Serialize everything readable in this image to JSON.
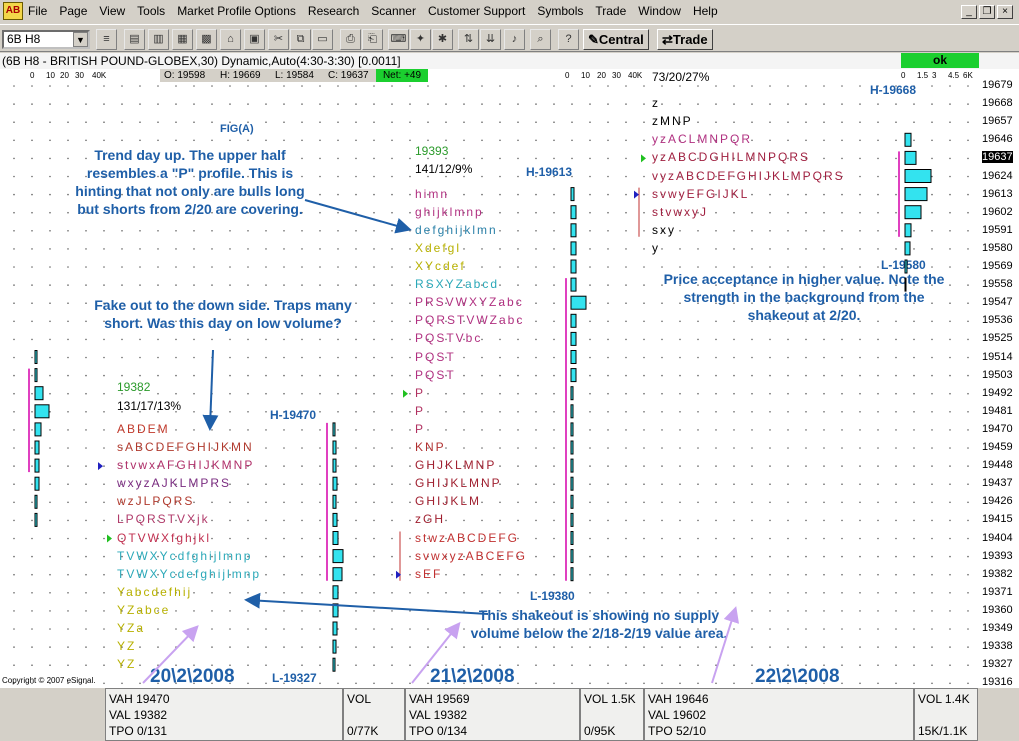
{
  "menu": {
    "items": [
      "File",
      "Page",
      "View",
      "Tools",
      "Market Profile Options",
      "Research",
      "Scanner",
      "Customer Support",
      "Symbols",
      "Trade",
      "Window",
      "Help"
    ]
  },
  "toolbar": {
    "symbol": "6B H8",
    "central_label": "Central",
    "trade_label": "Trade"
  },
  "chart_header": {
    "title": "(6B H8 - BRITISH POUND-GLOBEX,30) Dynamic,Auto(4:30-3:30) [0.0011]",
    "open": "O: 19598",
    "high": "H: 19669",
    "low": "L: 19584",
    "close": "C: 19637",
    "net": "Net: +49",
    "ok": "ok",
    "scale1": [
      "0",
      "10",
      "20",
      "30",
      "40K"
    ],
    "scale2": [
      "0",
      "10",
      "20",
      "30",
      "40K"
    ],
    "scale3": [
      "0",
      "1.5",
      "3",
      "4.5",
      "6K"
    ]
  },
  "prices": [
    "19679",
    "19668",
    "19657",
    "19646",
    "19637",
    "19624",
    "19613",
    "19602",
    "19591",
    "19580",
    "19569",
    "19558",
    "19547",
    "19536",
    "19525",
    "19514",
    "19503",
    "19492",
    "19481",
    "19470",
    "19459",
    "19448",
    "19437",
    "19426",
    "19415",
    "19404",
    "19393",
    "19382",
    "19371",
    "19360",
    "19349",
    "19338",
    "19327",
    "19316"
  ],
  "current_price": "19637",
  "annotations": {
    "fig": "FIG(A)",
    "note_trend": "Trend day up. The upper half resembles a \"P\" profile. This is hinting that not only are bulls long but shorts from 2/20 are covering.",
    "note_fake": "Fake out to the down side. Traps many short. Was this day on low volume?",
    "note_price": "Price acceptance in higher value. Note the strength in the background from the shakeout at 2/20.",
    "note_shake": "This shakeout is showing no supply volume below the 2/18-2/19 value area.",
    "copyright": "Copyright © 2007 eSignal."
  },
  "day1": {
    "date": "20\\2\\2008",
    "poc": "19382",
    "stats": "131/17/13%",
    "high": "H-19470",
    "low": "L-19327",
    "rows": [
      {
        "t": "ABDEM",
        "c": "#c0392b"
      },
      {
        "t": "sABCDEFGHIJKMN",
        "c": "#b03a2e"
      },
      {
        "t": "stvwxAFGHIJKMNP",
        "c": "#b0306a"
      },
      {
        "t": "wxyzAJKLMPRS",
        "c": "#7a2c80"
      },
      {
        "t": "wzJLPQRS",
        "c": "#b03a2e"
      },
      {
        "t": "LPQRSTVXjk",
        "c": "#b03a6a"
      },
      {
        "t": "QTVWXfghjkl",
        "c": "#c03050"
      },
      {
        "t": "TVWXYcdfghijlmnp",
        "c": "#2aa8b8"
      },
      {
        "t": "TVWXYcdefghijlmnp",
        "c": "#2aa8b8"
      },
      {
        "t": "Yabcdefhij",
        "c": "#b7b000"
      },
      {
        "t": "YZabce",
        "c": "#b7b000"
      },
      {
        "t": "YZa",
        "c": "#b7b000"
      },
      {
        "t": "YZ",
        "c": "#b7b000"
      },
      {
        "t": "YZ",
        "c": "#b7b000"
      }
    ]
  },
  "day2": {
    "date": "21\\2\\2008",
    "poc": "19393",
    "stats": "141/12/9%",
    "high": "H-19613",
    "low": "L-19380",
    "rows": [
      {
        "t": "himn",
        "c": "#b03080"
      },
      {
        "t": "ghijklmnp",
        "c": "#b03080"
      },
      {
        "t": "defghijklmn",
        "c": "#2a80a8"
      },
      {
        "t": "Xdefgl",
        "c": "#b7b000"
      },
      {
        "t": "XYcdef",
        "c": "#b7b000"
      },
      {
        "t": "RSXYZabcd",
        "c": "#2aa8b8"
      },
      {
        "t": "PRSVWXYZabc",
        "c": "#b03080"
      },
      {
        "t": "PQRSTVWZabc",
        "c": "#b03080"
      },
      {
        "t": "PQSTVbc",
        "c": "#b03080"
      },
      {
        "t": "PQST",
        "c": "#b03080"
      },
      {
        "t": "PQST",
        "c": "#b03080"
      },
      {
        "t": "P",
        "c": "#b03060"
      },
      {
        "t": "P",
        "c": "#b03060"
      },
      {
        "t": "P",
        "c": "#b03060"
      },
      {
        "t": "KNP",
        "c": "#b03030"
      },
      {
        "t": "GHJKLMNP",
        "c": "#a02030"
      },
      {
        "t": "GHIJKLMNP",
        "c": "#a02030"
      },
      {
        "t": "GHIJKLM",
        "c": "#a02030"
      },
      {
        "t": "zGH",
        "c": "#a02030"
      },
      {
        "t": "stwzABCDEFG",
        "c": "#c03030"
      },
      {
        "t": "svwxyzABCEFG",
        "c": "#c03030"
      },
      {
        "t": "sEF",
        "c": "#c03030"
      }
    ]
  },
  "day3": {
    "date": "22\\2\\2008",
    "stats": "73/20/27%",
    "high": "H-19668",
    "low": "L-19580",
    "rows": [
      {
        "t": "z",
        "c": "#000"
      },
      {
        "t": "zMNP",
        "c": "#000"
      },
      {
        "t": "yzACLMNPQR",
        "c": "#b03080"
      },
      {
        "t": "yzABCDGHILMNPQRS",
        "c": "#a02040"
      },
      {
        "t": "vyzABCDEFGHIJKLMPQRS",
        "c": "#a02040"
      },
      {
        "t": "svwyEFGIJKL",
        "c": "#a02040"
      },
      {
        "t": "stvwxyJ",
        "c": "#a02040"
      },
      {
        "t": "sxy",
        "c": "#000"
      },
      {
        "t": "y",
        "c": "#000"
      }
    ]
  },
  "status": {
    "day1": {
      "vah": "VAH 19470",
      "val": "VAL  19382",
      "tpo": "TPO 0/131",
      "vol": "VOL",
      "vol2": "0/77K"
    },
    "day2": {
      "vah": "VAH 19569",
      "val": "VAL  19382",
      "tpo": "TPO 0/134",
      "vol": "VOL 1.5K",
      "vol2": "0/95K"
    },
    "day3": {
      "vah": "VAH 19646",
      "val": "VAL  19602",
      "tpo": "TPO 52/10",
      "vol": "VOL 1.4K",
      "vol2": "15K/1.1K"
    }
  },
  "colors": {
    "accent": "#1f5fa8",
    "histogram": "#33e3ef",
    "value_line": "#e040c0",
    "ok_green": "#1bcf2f"
  }
}
